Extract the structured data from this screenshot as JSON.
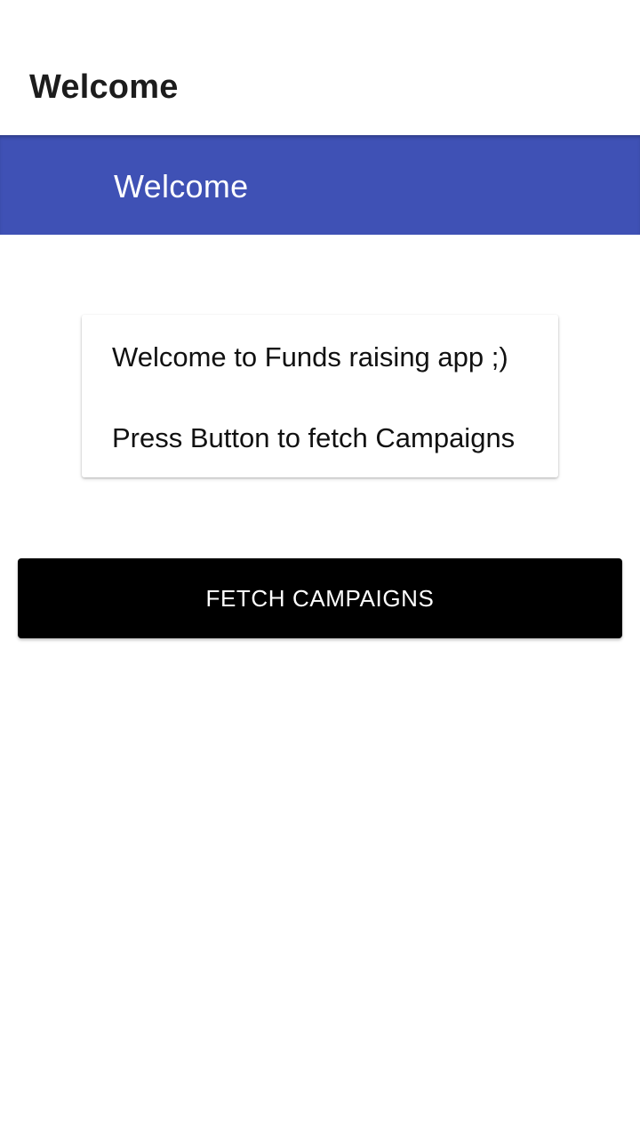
{
  "window": {
    "title": "Welcome"
  },
  "app_bar": {
    "title": "Welcome",
    "color": "#3f51b5"
  },
  "card": {
    "line1": "Welcome to Funds raising app ;)",
    "line2": "Press Button to fetch Campaigns"
  },
  "fetch_button": {
    "label": "FETCH CAMPAIGNS",
    "background": "#000000",
    "text_color": "#ffffff"
  }
}
